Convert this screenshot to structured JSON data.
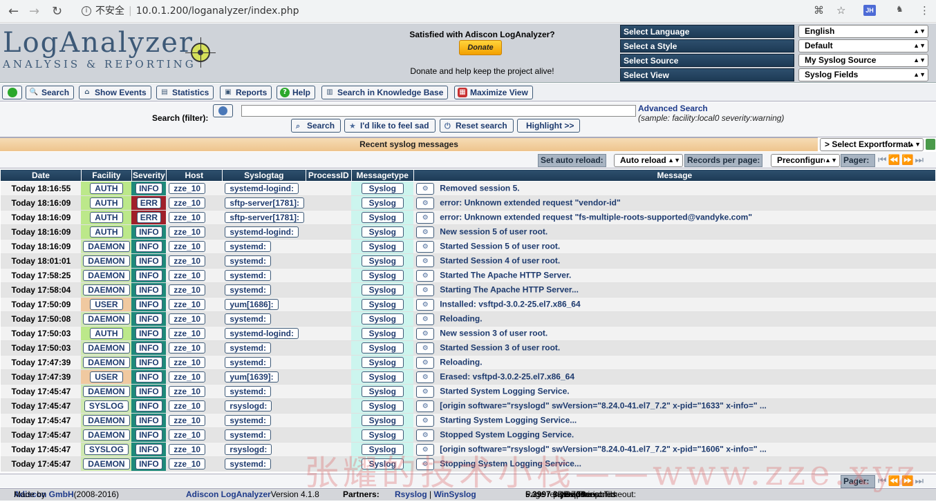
{
  "browser": {
    "security_label": "不安全",
    "url": "10.0.1.200/loganalyzer/index.php",
    "profile_badge": "JH"
  },
  "header": {
    "logo_title": "LogAnalyzer",
    "logo_subtitle": "ANALYSIS & REPORTING",
    "donate_question": "Satisfied with Adiscon LogAnalyzer?",
    "donate_button": "Donate",
    "donate_note": "Donate and help keep the project alive!",
    "selects": [
      {
        "label": "Select Language",
        "value": "English"
      },
      {
        "label": "Select a Style",
        "value": "Default"
      },
      {
        "label": "Select Source",
        "value": "My Syslog Source"
      },
      {
        "label": "Select View",
        "value": "Syslog Fields"
      }
    ]
  },
  "menu": {
    "search": "Search",
    "show_events": "Show Events",
    "statistics": "Statistics",
    "reports": "Reports",
    "help": "Help",
    "kb_search": "Search in Knowledge Base",
    "maximize": "Maximize View"
  },
  "search": {
    "label": "Search (filter):",
    "value": "",
    "advanced": "Advanced Search",
    "sample": "(sample: facility:local0 severity:warning)",
    "btn_search": "Search",
    "btn_lucky": "I'd like to feel sad",
    "btn_reset": "Reset search",
    "btn_highlight": "Highlight >>"
  },
  "section": {
    "title": "Recent syslog messages",
    "export": "> Select Exportformat"
  },
  "options": {
    "auto_reload_label": "Set auto reload:",
    "auto_reload_value": "Auto reload d",
    "records_label": "Records per page:",
    "records_value": "Preconfigured",
    "pager_label": "Pager:"
  },
  "columns": [
    "Date",
    "Facility",
    "Severity",
    "Host",
    "Syslogtag",
    "ProcessID",
    "Messagetype",
    "Message"
  ],
  "colors": {
    "auth": "#bce88a",
    "daemon": "#cfe9b0",
    "user": "#f0c9a0",
    "syslog": "#cfe9b0",
    "info": "#1e8a7a",
    "err": "#a0202a",
    "msgtype": "#ccf5ee",
    "header_blue": "#1d3a55"
  },
  "rows": [
    {
      "date": "Today 18:16:55",
      "facility": "AUTH",
      "fc": "auth",
      "severity": "INFO",
      "sc": "info",
      "host": "zze_10",
      "tag": "systemd-logind:",
      "mtype": "Syslog",
      "msg": "Removed session 5."
    },
    {
      "date": "Today 18:16:09",
      "facility": "AUTH",
      "fc": "auth",
      "severity": "ERR",
      "sc": "err",
      "host": "zze_10",
      "tag": "sftp-server[1781]:",
      "mtype": "Syslog",
      "msg": "error: Unknown extended request \"vendor-id\""
    },
    {
      "date": "Today 18:16:09",
      "facility": "AUTH",
      "fc": "auth",
      "severity": "ERR",
      "sc": "err",
      "host": "zze_10",
      "tag": "sftp-server[1781]:",
      "mtype": "Syslog",
      "msg": "error: Unknown extended request \"fs-multiple-roots-supported@vandyke.com\""
    },
    {
      "date": "Today 18:16:09",
      "facility": "AUTH",
      "fc": "auth",
      "severity": "INFO",
      "sc": "info",
      "host": "zze_10",
      "tag": "systemd-logind:",
      "mtype": "Syslog",
      "msg": "New session 5 of user root."
    },
    {
      "date": "Today 18:16:09",
      "facility": "DAEMON",
      "fc": "daemon",
      "severity": "INFO",
      "sc": "info",
      "host": "zze_10",
      "tag": "systemd:",
      "mtype": "Syslog",
      "msg": "Started Session 5 of user root."
    },
    {
      "date": "Today 18:01:01",
      "facility": "DAEMON",
      "fc": "daemon",
      "severity": "INFO",
      "sc": "info",
      "host": "zze_10",
      "tag": "systemd:",
      "mtype": "Syslog",
      "msg": "Started Session 4 of user root."
    },
    {
      "date": "Today 17:58:25",
      "facility": "DAEMON",
      "fc": "daemon",
      "severity": "INFO",
      "sc": "info",
      "host": "zze_10",
      "tag": "systemd:",
      "mtype": "Syslog",
      "msg": "Started The Apache HTTP Server."
    },
    {
      "date": "Today 17:58:04",
      "facility": "DAEMON",
      "fc": "daemon",
      "severity": "INFO",
      "sc": "info",
      "host": "zze_10",
      "tag": "systemd:",
      "mtype": "Syslog",
      "msg": "Starting The Apache HTTP Server..."
    },
    {
      "date": "Today 17:50:09",
      "facility": "USER",
      "fc": "user",
      "severity": "INFO",
      "sc": "info",
      "host": "zze_10",
      "tag": "yum[1686]:",
      "mtype": "Syslog",
      "msg": "Installed: vsftpd-3.0.2-25.el7.x86_64"
    },
    {
      "date": "Today 17:50:08",
      "facility": "DAEMON",
      "fc": "daemon",
      "severity": "INFO",
      "sc": "info",
      "host": "zze_10",
      "tag": "systemd:",
      "mtype": "Syslog",
      "msg": "Reloading."
    },
    {
      "date": "Today 17:50:03",
      "facility": "AUTH",
      "fc": "auth",
      "severity": "INFO",
      "sc": "info",
      "host": "zze_10",
      "tag": "systemd-logind:",
      "mtype": "Syslog",
      "msg": "New session 3 of user root."
    },
    {
      "date": "Today 17:50:03",
      "facility": "DAEMON",
      "fc": "daemon",
      "severity": "INFO",
      "sc": "info",
      "host": "zze_10",
      "tag": "systemd:",
      "mtype": "Syslog",
      "msg": "Started Session 3 of user root."
    },
    {
      "date": "Today 17:47:39",
      "facility": "DAEMON",
      "fc": "daemon",
      "severity": "INFO",
      "sc": "info",
      "host": "zze_10",
      "tag": "systemd:",
      "mtype": "Syslog",
      "msg": "Reloading."
    },
    {
      "date": "Today 17:47:39",
      "facility": "USER",
      "fc": "user",
      "severity": "INFO",
      "sc": "info",
      "host": "zze_10",
      "tag": "yum[1639]:",
      "mtype": "Syslog",
      "msg": "Erased: vsftpd-3.0.2-25.el7.x86_64"
    },
    {
      "date": "Today 17:45:47",
      "facility": "DAEMON",
      "fc": "daemon",
      "severity": "INFO",
      "sc": "info",
      "host": "zze_10",
      "tag": "systemd:",
      "mtype": "Syslog",
      "msg": "Started System Logging Service."
    },
    {
      "date": "Today 17:45:47",
      "facility": "SYSLOG",
      "fc": "syslog",
      "severity": "INFO",
      "sc": "info",
      "host": "zze_10",
      "tag": "rsyslogd:",
      "mtype": "Syslog",
      "msg": "[origin software=\"rsyslogd\" swVersion=\"8.24.0-41.el7_7.2\" x-pid=\"1633\" x-info=\" ..."
    },
    {
      "date": "Today 17:45:47",
      "facility": "DAEMON",
      "fc": "daemon",
      "severity": "INFO",
      "sc": "info",
      "host": "zze_10",
      "tag": "systemd:",
      "mtype": "Syslog",
      "msg": "Starting System Logging Service..."
    },
    {
      "date": "Today 17:45:47",
      "facility": "DAEMON",
      "fc": "daemon",
      "severity": "INFO",
      "sc": "info",
      "host": "zze_10",
      "tag": "systemd:",
      "mtype": "Syslog",
      "msg": "Stopped System Logging Service."
    },
    {
      "date": "Today 17:45:47",
      "facility": "SYSLOG",
      "fc": "syslog",
      "severity": "INFO",
      "sc": "info",
      "host": "zze_10",
      "tag": "rsyslogd:",
      "mtype": "Syslog",
      "msg": "[origin software=\"rsyslogd\" swVersion=\"8.24.0-41.el7_7.2\" x-pid=\"1606\" x-info=\" ..."
    },
    {
      "date": "Today 17:45:47",
      "facility": "DAEMON",
      "fc": "daemon",
      "severity": "INFO",
      "sc": "info",
      "host": "zze_10",
      "tag": "systemd:",
      "mtype": "Syslog",
      "msg": "Stopping System Logging Service..."
    }
  ],
  "footer": {
    "made_by_prefix": "Made by",
    "made_by_link": "Adiscon GmbH",
    "made_by_years": "(2008-2016)",
    "product_link": "Adiscon LogAnalyzer",
    "version": "Version 4.1.8",
    "partners_label": "Partners:",
    "partner1": "Rsyslog",
    "partner2": "WinSyslog",
    "rendered_label": "Page rendered in:",
    "rendered_value": "5.3997",
    "rendered_unit": "seconds",
    "db_label": "| DB queries:",
    "db_value": "3",
    "gzip_label": "| GZIP enabled:",
    "gzip_value": "yes",
    "timeout_label": "| Script Timeout:",
    "timeout_value": "30",
    "timeout_unit": "seconds"
  },
  "watermark": "张耀的技术小栈——www.zze.xyz"
}
